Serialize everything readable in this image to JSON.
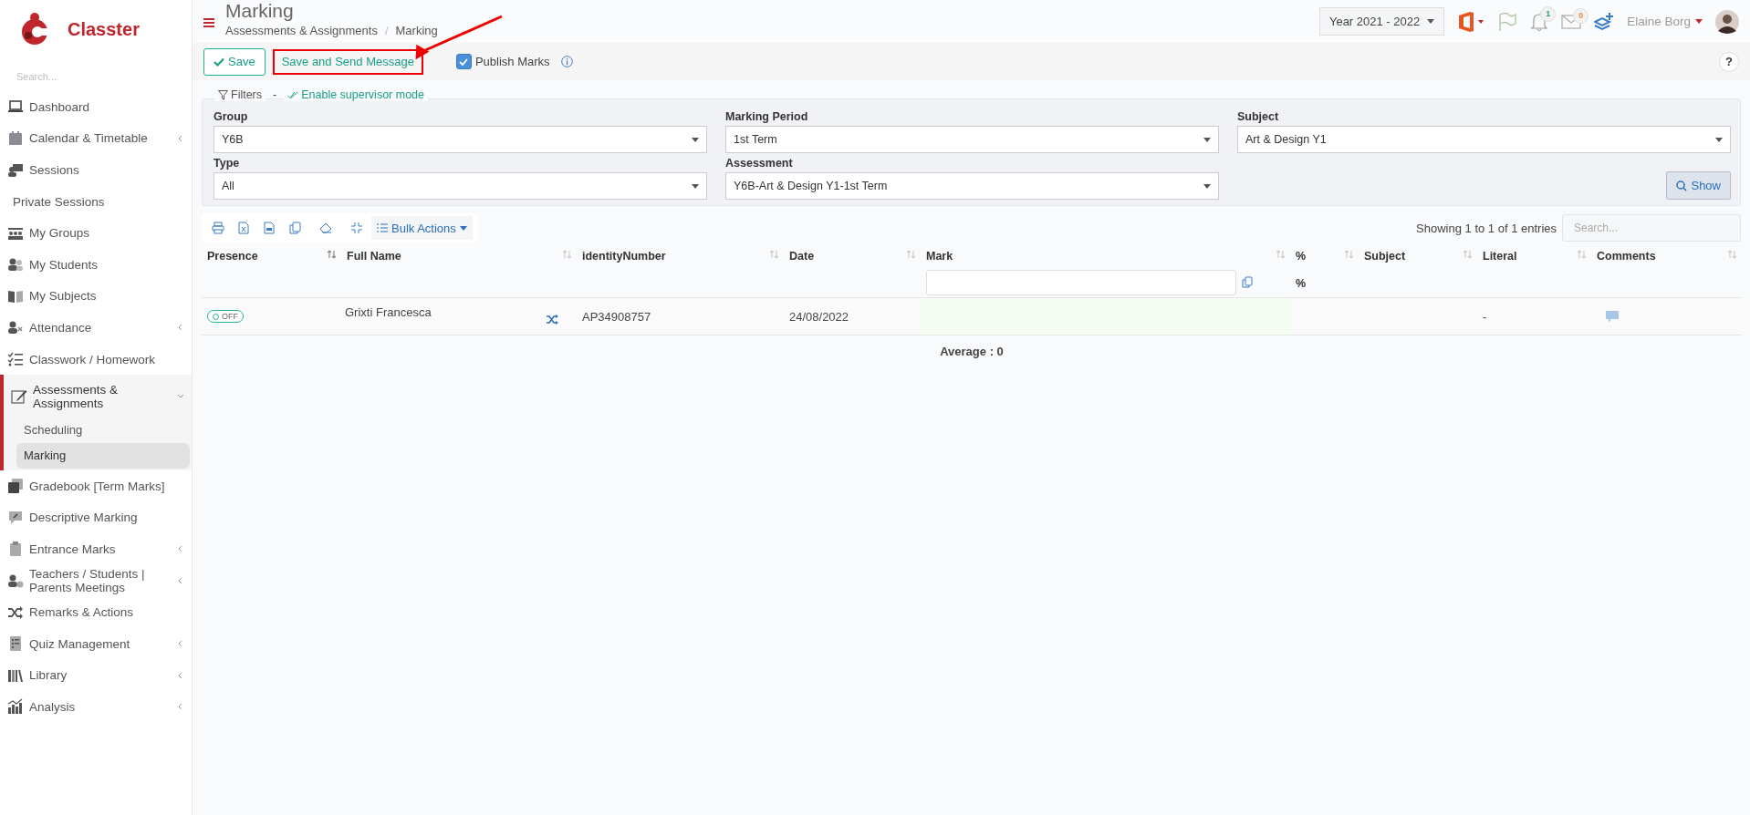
{
  "sidebar": {
    "logo_text": "Classter",
    "search": {
      "placeholder": "Search..."
    },
    "items": [
      {
        "label": "Dashboard",
        "has_submenu": false,
        "expanded": false
      },
      {
        "label": "Calendar & Timetable",
        "has_submenu": true,
        "expanded": false
      },
      {
        "label": "Sessions",
        "has_submenu": false,
        "expanded": false
      },
      {
        "label": "Private Sessions",
        "has_submenu": false,
        "expanded": false
      },
      {
        "label": "My Groups",
        "has_submenu": false,
        "expanded": false
      },
      {
        "label": "My Students",
        "has_submenu": false,
        "expanded": false
      },
      {
        "label": "My Subjects",
        "has_submenu": false,
        "expanded": false
      },
      {
        "label": "Attendance",
        "has_submenu": true,
        "expanded": false
      },
      {
        "label": "Classwork / Homework",
        "has_submenu": false,
        "expanded": false
      },
      {
        "label": "Assessments & Assignments",
        "has_submenu": true,
        "expanded": true,
        "children": [
          {
            "label": "Scheduling",
            "selected": false
          },
          {
            "label": "Marking",
            "selected": true
          }
        ]
      },
      {
        "label": "Gradebook [Term Marks]",
        "has_submenu": false,
        "expanded": false
      },
      {
        "label": "Descriptive Marking",
        "has_submenu": false,
        "expanded": false
      },
      {
        "label": "Entrance Marks",
        "has_submenu": true,
        "expanded": false
      },
      {
        "label": "Teachers / Students | Parents Meetings",
        "has_submenu": true,
        "expanded": false
      },
      {
        "label": "Remarks & Actions",
        "has_submenu": false,
        "expanded": false
      },
      {
        "label": "Quiz Management",
        "has_submenu": true,
        "expanded": false
      },
      {
        "label": "Library",
        "has_submenu": true,
        "expanded": false
      },
      {
        "label": "Analysis",
        "has_submenu": true,
        "expanded": false
      }
    ]
  },
  "header": {
    "title": "Marking",
    "breadcrumb": {
      "items": [
        "Assessments & Assignments",
        "Marking"
      ],
      "separator": "/"
    },
    "year": "Year 2021 - 2022",
    "notifications_count": "1",
    "messages_count": "0",
    "user": "Elaine Borg"
  },
  "toolbar": {
    "save": "Save",
    "save_send": {
      "label": "Save and Send Message",
      "highlighted": true
    },
    "publish": {
      "label": "Publish Marks",
      "checked": true
    },
    "help": "?"
  },
  "filters": {
    "label": "Filters",
    "separator": "-",
    "supervisor_link": "Enable supervisor mode",
    "fields": [
      {
        "label": "Group",
        "value": "Y6B"
      },
      {
        "label": "Marking Period",
        "value": "1st Term"
      },
      {
        "label": "Subject",
        "value": "Art & Design Y1"
      },
      {
        "label": "Type",
        "value": "All"
      },
      {
        "label": "Assessment",
        "value": "Y6B-Art & Design Y1-1st Term"
      }
    ],
    "show_button": "Show"
  },
  "table": {
    "bulk_actions": "Bulk Actions",
    "info": "Showing 1 to 1 of 1 entries",
    "search": {
      "placeholder": "Search..."
    },
    "columns": [
      {
        "label": "Presence",
        "sorted": true
      },
      {
        "label": "Full Name",
        "sorted": false
      },
      {
        "label": "identityNumber",
        "sorted": false
      },
      {
        "label": "Date",
        "sorted": false
      },
      {
        "label": "Mark",
        "sorted": false
      },
      {
        "label": "%",
        "sorted": false
      },
      {
        "label": "Subject",
        "sorted": false
      },
      {
        "label": "Literal",
        "sorted": false
      },
      {
        "label": "Comments",
        "sorted": false
      }
    ],
    "percent_subheader": "%",
    "rows": [
      {
        "presence": {
          "label": "OFF",
          "on": false
        },
        "full_name": "Grixti Francesca",
        "identity_number": "AP34908757",
        "date": "24/08/2022",
        "literal": "-"
      }
    ],
    "average": "Average : 0"
  }
}
